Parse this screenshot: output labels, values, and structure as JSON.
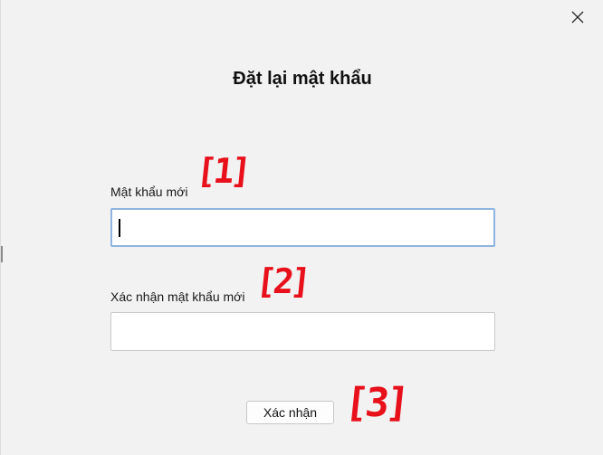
{
  "dialog": {
    "title": "Đặt lại mật khẩu",
    "close_icon": "close-icon"
  },
  "fields": {
    "new_password": {
      "label": "Mật khẩu mới",
      "value": ""
    },
    "confirm_password": {
      "label": "Xác nhận mật khẩu mới",
      "value": ""
    }
  },
  "actions": {
    "confirm_label": "Xác nhận"
  },
  "annotations": {
    "a1": "[1]",
    "a2": "[2]",
    "a3": "[3]",
    "color": "#e8101a"
  },
  "colors": {
    "background": "#f2f2f2",
    "focus_border": "#8fb4df"
  }
}
